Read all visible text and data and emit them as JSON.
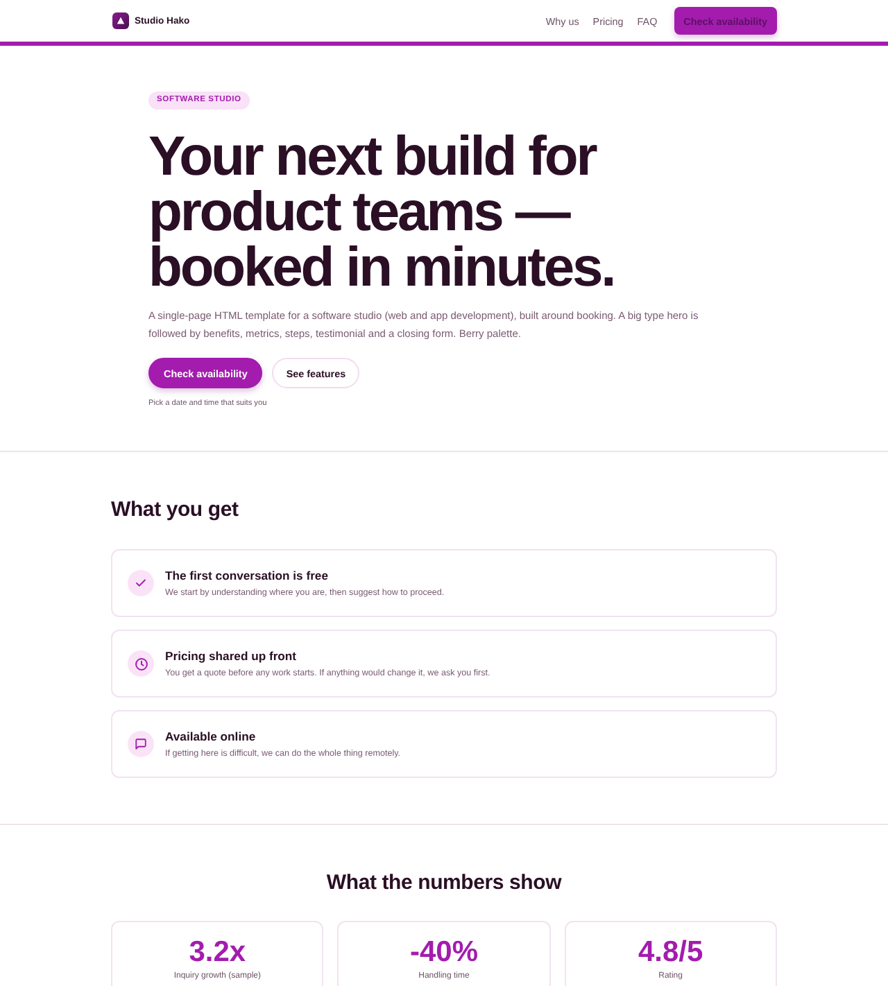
{
  "header": {
    "brand": "Studio Hako",
    "nav": [
      {
        "label": "Why us"
      },
      {
        "label": "Pricing"
      },
      {
        "label": "FAQ"
      }
    ],
    "cta": "Check availability"
  },
  "hero": {
    "badge": "SOFTWARE STUDIO",
    "headline": "Your next build for product teams — booked in minutes.",
    "description": "A single-page HTML template for a software studio (web and app development), built around booking. A big type hero is followed by benefits, metrics, steps, testimonial and a closing form. Berry palette.",
    "buttons": [
      {
        "label": "Check availability",
        "kind": "primary"
      },
      {
        "label": "See features",
        "kind": "secondary"
      }
    ],
    "note": "Pick a date and time that suits you"
  },
  "benefits": {
    "title": "What you get",
    "items": [
      {
        "title": "The first conversation is free",
        "text": "We start by understanding where you are, then suggest how to proceed."
      },
      {
        "title": "Pricing shared up front",
        "text": "You get a quote before any work starts. If anything would change it, we ask you first."
      },
      {
        "title": "Available online",
        "text": "If getting here is difficult, we can do the whole thing remotely."
      }
    ]
  },
  "metrics": {
    "title": "What the numbers show",
    "items": [
      {
        "value": "3.2x",
        "label": "Inquiry growth (sample)"
      },
      {
        "value": "-40%",
        "label": "Handling time"
      },
      {
        "value": "4.8/5",
        "label": "Rating"
      }
    ]
  }
}
